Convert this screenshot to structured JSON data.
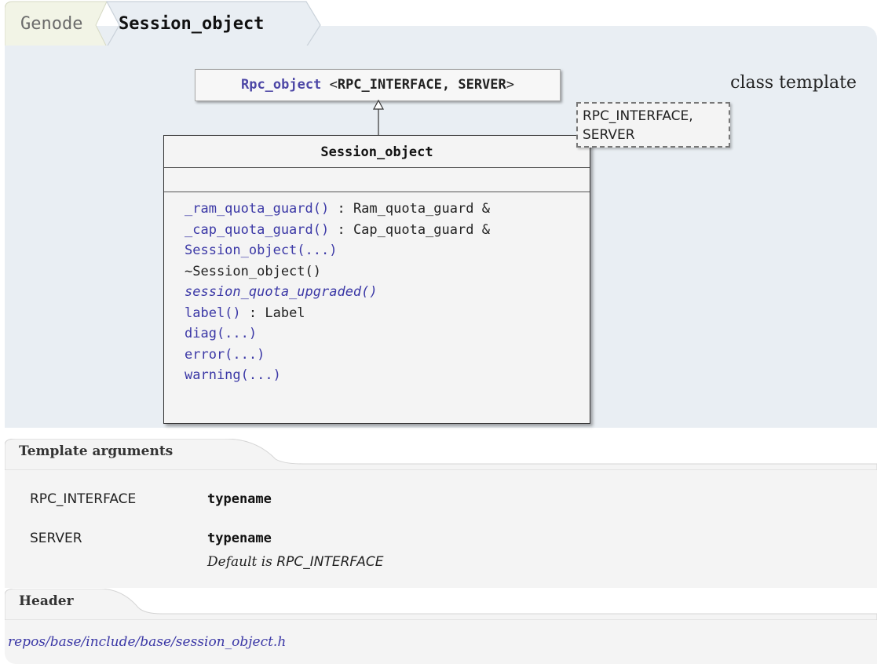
{
  "breadcrumb": {
    "items": [
      "Genode",
      "Session_object"
    ]
  },
  "kind_label": "class template",
  "base_class": {
    "name": "Rpc_object",
    "args_open": "<",
    "args": "RPC_INTERFACE, SERVER",
    "args_close": ">"
  },
  "template_params_box": {
    "line1": "RPC_INTERFACE,",
    "line2": "SERVER"
  },
  "class_box": {
    "name": "Session_object",
    "methods": [
      {
        "name": "_ram_quota_guard()",
        "suffix": " : Ram_quota_guard &",
        "link": true,
        "italic": false
      },
      {
        "name": "_cap_quota_guard()",
        "suffix": " : Cap_quota_guard &",
        "link": true,
        "italic": false
      },
      {
        "name": "Session_object(...)",
        "suffix": "",
        "link": true,
        "italic": false
      },
      {
        "name": "~Session_object()",
        "suffix": "",
        "link": false,
        "italic": false
      },
      {
        "name": "session_quota_upgraded()",
        "suffix": "",
        "link": true,
        "italic": true
      },
      {
        "name": "label()",
        "suffix": " : Label",
        "link": true,
        "italic": false
      },
      {
        "name": "diag(...)",
        "suffix": "",
        "link": true,
        "italic": false
      },
      {
        "name": "error(...)",
        "suffix": "",
        "link": true,
        "italic": false
      },
      {
        "name": "warning(...)",
        "suffix": "",
        "link": true,
        "italic": false
      }
    ]
  },
  "template_arguments": {
    "title": "Template arguments",
    "rows": [
      {
        "name": "RPC_INTERFACE",
        "type": "typename",
        "default_prefix": "",
        "default_value": ""
      },
      {
        "name": "SERVER",
        "type": "typename",
        "default_prefix": "Default is ",
        "default_value": "RPC_INTERFACE"
      }
    ]
  },
  "header_section": {
    "title": "Header",
    "path": "repos/base/include/base/session_object.h"
  },
  "colors": {
    "panel_bg": "#e9eef3",
    "link": "#3b38a6",
    "section_bg": "#f4f4f4"
  }
}
